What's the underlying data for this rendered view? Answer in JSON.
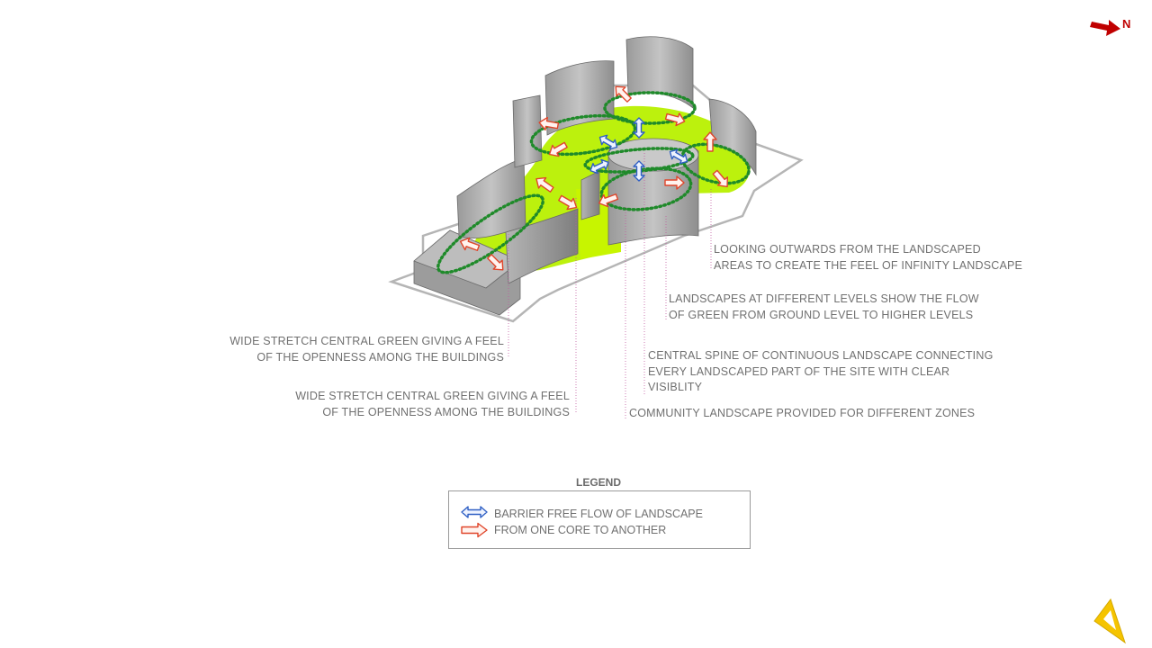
{
  "north": {
    "label": "N",
    "color": "#c00000"
  },
  "annotations": [
    {
      "id": "infinity",
      "text": "LOOKING OUTWARDS FROM THE LANDSCAPED\nAREAS TO CREATE THE FEEL OF INFINITY LANDSCAPE"
    },
    {
      "id": "levels",
      "text": "LANDSCAPES AT DIFFERENT LEVELS SHOW THE FLOW\nOF GREEN FROM GROUND LEVEL TO HIGHER LEVELS"
    },
    {
      "id": "green1",
      "text": "WIDE STRETCH CENTRAL GREEN GIVING A FEEL\nOF THE OPENNESS AMONG THE BUILDINGS"
    },
    {
      "id": "spine",
      "text": "CENTRAL SPINE OF CONTINUOUS LANDSCAPE CONNECTING\nEVERY LANDSCAPED PART OF THE SITE WITH CLEAR\nVISIBLITY"
    },
    {
      "id": "green2",
      "text": "WIDE STRETCH CENTRAL GREEN GIVING A FEEL\nOF THE OPENNESS AMONG THE BUILDINGS"
    },
    {
      "id": "community",
      "text": "COMMUNITY LANDSCAPE PROVIDED FOR DIFFERENT ZONES"
    }
  ],
  "legend": {
    "title": "LEGEND",
    "text": "BARRIER FREE FLOW OF LANDSCAPE\nFROM ONE CORE TO ANOTHER",
    "items": [
      {
        "icon": "blue-double-arrow-icon",
        "color": "#2e5fc4"
      },
      {
        "icon": "red-arrow-icon",
        "color": "#e0452a"
      }
    ]
  },
  "colors": {
    "landscape": "#b8f000",
    "path": "#1f8a2a",
    "building": "#a8a8a8",
    "leader": "#c05aa0"
  }
}
